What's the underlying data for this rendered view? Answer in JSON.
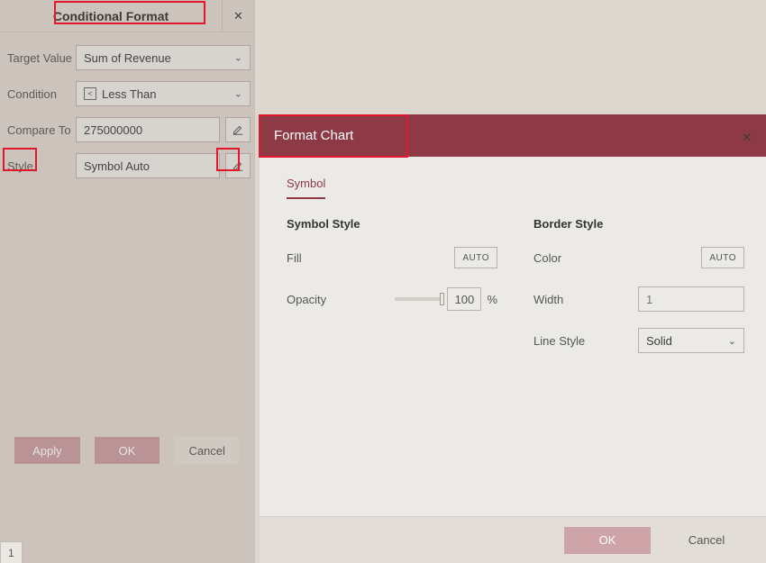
{
  "leftPanel": {
    "title": "Conditional Format",
    "labels": {
      "targetValue": "Target Value",
      "condition": "Condition",
      "compareTo": "Compare To",
      "style": "Style"
    },
    "fields": {
      "targetValue": "Sum of Revenue",
      "condition": "Less Than",
      "compareTo": "275000000",
      "style": "Symbol  Auto"
    },
    "buttons": {
      "apply": "Apply",
      "ok": "OK",
      "cancel": "Cancel"
    }
  },
  "sheetTab": "1",
  "dialog": {
    "title": "Format Chart",
    "tab": "Symbol",
    "sections": {
      "symbolStyle": "Symbol Style",
      "borderStyle": "Border Style"
    },
    "labels": {
      "fill": "Fill",
      "opacity": "Opacity",
      "color": "Color",
      "width": "Width",
      "lineStyle": "Line Style"
    },
    "values": {
      "fill": "AUTO",
      "opacity": "100",
      "opacityUnit": "%",
      "color": "AUTO",
      "width": "1",
      "lineStyle": "Solid"
    },
    "buttons": {
      "ok": "OK",
      "cancel": "Cancel"
    }
  }
}
